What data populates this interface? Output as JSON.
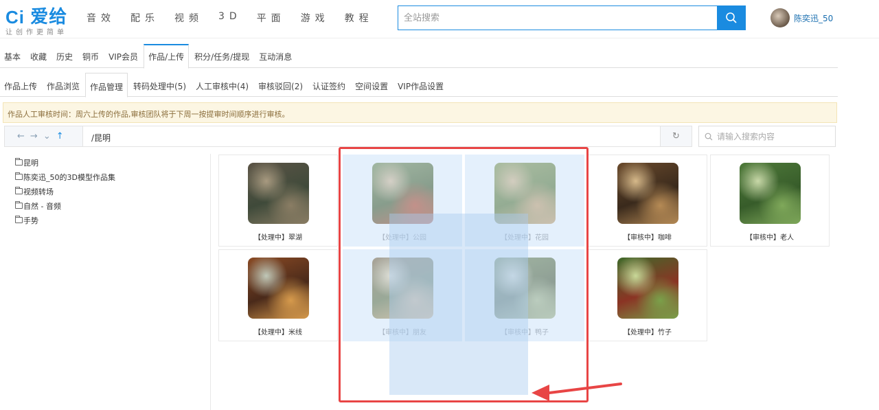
{
  "header": {
    "logo_text": "爱给",
    "logo_tagline": "让创作更简单",
    "nav": [
      "音效",
      "配乐",
      "视频",
      "3D",
      "平面",
      "游戏",
      "教程"
    ],
    "search_placeholder": "全站搜索",
    "username": "陈奕迅_50"
  },
  "tabs_primary": [
    "基本",
    "收藏",
    "历史",
    "铜币",
    "VIP会员",
    "作品/上传",
    "积分/任务/提现",
    "互动消息"
  ],
  "tabs_primary_active": "作品/上传",
  "tabs_secondary": [
    "作品上传",
    "作品浏览",
    "作品管理",
    "转码处理中(5)",
    "人工审核中(4)",
    "审核驳回(2)",
    "认证签约",
    "空间设置",
    "VIP作品设置"
  ],
  "tabs_secondary_active": "作品管理",
  "notice": "作品人工审核时间：周六上传的作品,审核团队将于下周一按提审时间顺序进行审核。",
  "pathbar": {
    "path": "/昆明",
    "search_placeholder": "请输入搜索内容"
  },
  "tree": [
    "昆明",
    "陈奕迅_50的3D模型作品集",
    "视频转场",
    "自然 - 音频",
    "手势"
  ],
  "files": [
    {
      "caption": "【处理中】翠湖",
      "selected": false,
      "palette": [
        "#5c5446",
        "#8a7d64",
        "#3f4a3a",
        "#a89a80"
      ]
    },
    {
      "caption": "【处理中】公园",
      "selected": true,
      "palette": [
        "#6d8a5a",
        "#a8442e",
        "#3d5a32",
        "#c9b79c"
      ]
    },
    {
      "caption": "【处理中】花园",
      "selected": true,
      "palette": [
        "#7c9457",
        "#b99b72",
        "#54763f",
        "#c6b28f"
      ]
    },
    {
      "caption": "【审核中】咖啡",
      "selected": false,
      "palette": [
        "#6a4a2c",
        "#b58a55",
        "#3a2a1c",
        "#d6b98a"
      ]
    },
    {
      "caption": "【审核中】老人",
      "selected": false,
      "palette": [
        "#4f7a3a",
        "#7fa85a",
        "#375c2a",
        "#c8d8a8"
      ]
    },
    {
      "caption": "【处理中】米线",
      "selected": false,
      "palette": [
        "#8a4a24",
        "#d69a4c",
        "#4a2a1a",
        "#c0c8b8"
      ]
    },
    {
      "caption": "【审核中】朋友",
      "selected": true,
      "palette": [
        "#7a6648",
        "#c9a678",
        "#5e7048",
        "#d8d0b8"
      ]
    },
    {
      "caption": "【审核中】鸭子",
      "selected": true,
      "palette": [
        "#6a8458",
        "#9ab08c",
        "#4a5e42",
        "#d0d4c4"
      ]
    },
    {
      "caption": "【处理中】竹子",
      "selected": false,
      "palette": [
        "#3f6a2a",
        "#7aa04a",
        "#8a3424",
        "#c8d898"
      ]
    }
  ]
}
